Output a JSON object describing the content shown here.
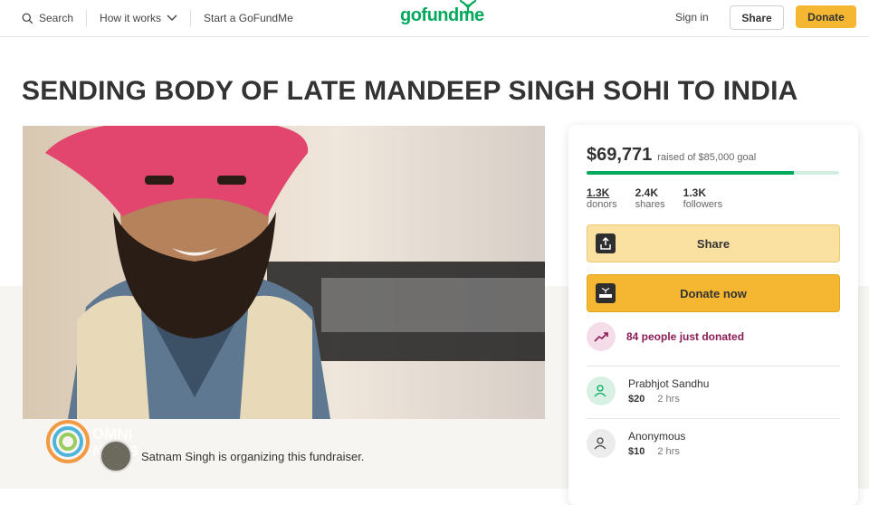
{
  "header": {
    "search_label": "Search",
    "how_it_works_label": "How it works",
    "start_label": "Start a GoFundMe",
    "logo_text": "gofundme",
    "signin_label": "Sign in",
    "share_label": "Share",
    "donate_label": "Donate"
  },
  "campaign": {
    "title": "SENDING BODY OF LATE MANDEEP SINGH SOHI TO INDIA",
    "organizer_text": "Satnam Singh is organizing this fundraiser.",
    "raised": "$69,771",
    "goal_text": "raised of $85,000 goal",
    "progress_fraction": 0.821,
    "stats": {
      "donors": "1.3K",
      "donors_label": "donors",
      "shares": "2.4K",
      "shares_label": "shares",
      "followers": "1.3K",
      "followers_label": "followers"
    },
    "share_button": "Share",
    "donate_button": "Donate now",
    "recent_text": "84 people just donated",
    "donations": [
      {
        "name": "Prabhjot Sandhu",
        "amount": "$20",
        "time": "2 hrs"
      },
      {
        "name": "Anonymous",
        "amount": "$10",
        "time": "2 hrs"
      }
    ]
  },
  "watermark": {
    "line1": "OMNI",
    "line2": "NEWS"
  },
  "colors": {
    "brand_green": "#02a95c",
    "donate_yellow": "#f5b731",
    "share_yellow": "#fbe1a1",
    "trend_magenta": "#8a1c56"
  },
  "icons": [
    "search-icon",
    "chevron-down-icon",
    "share-icon",
    "gofundme-me-icon",
    "trend-up-icon",
    "donor-icon"
  ]
}
